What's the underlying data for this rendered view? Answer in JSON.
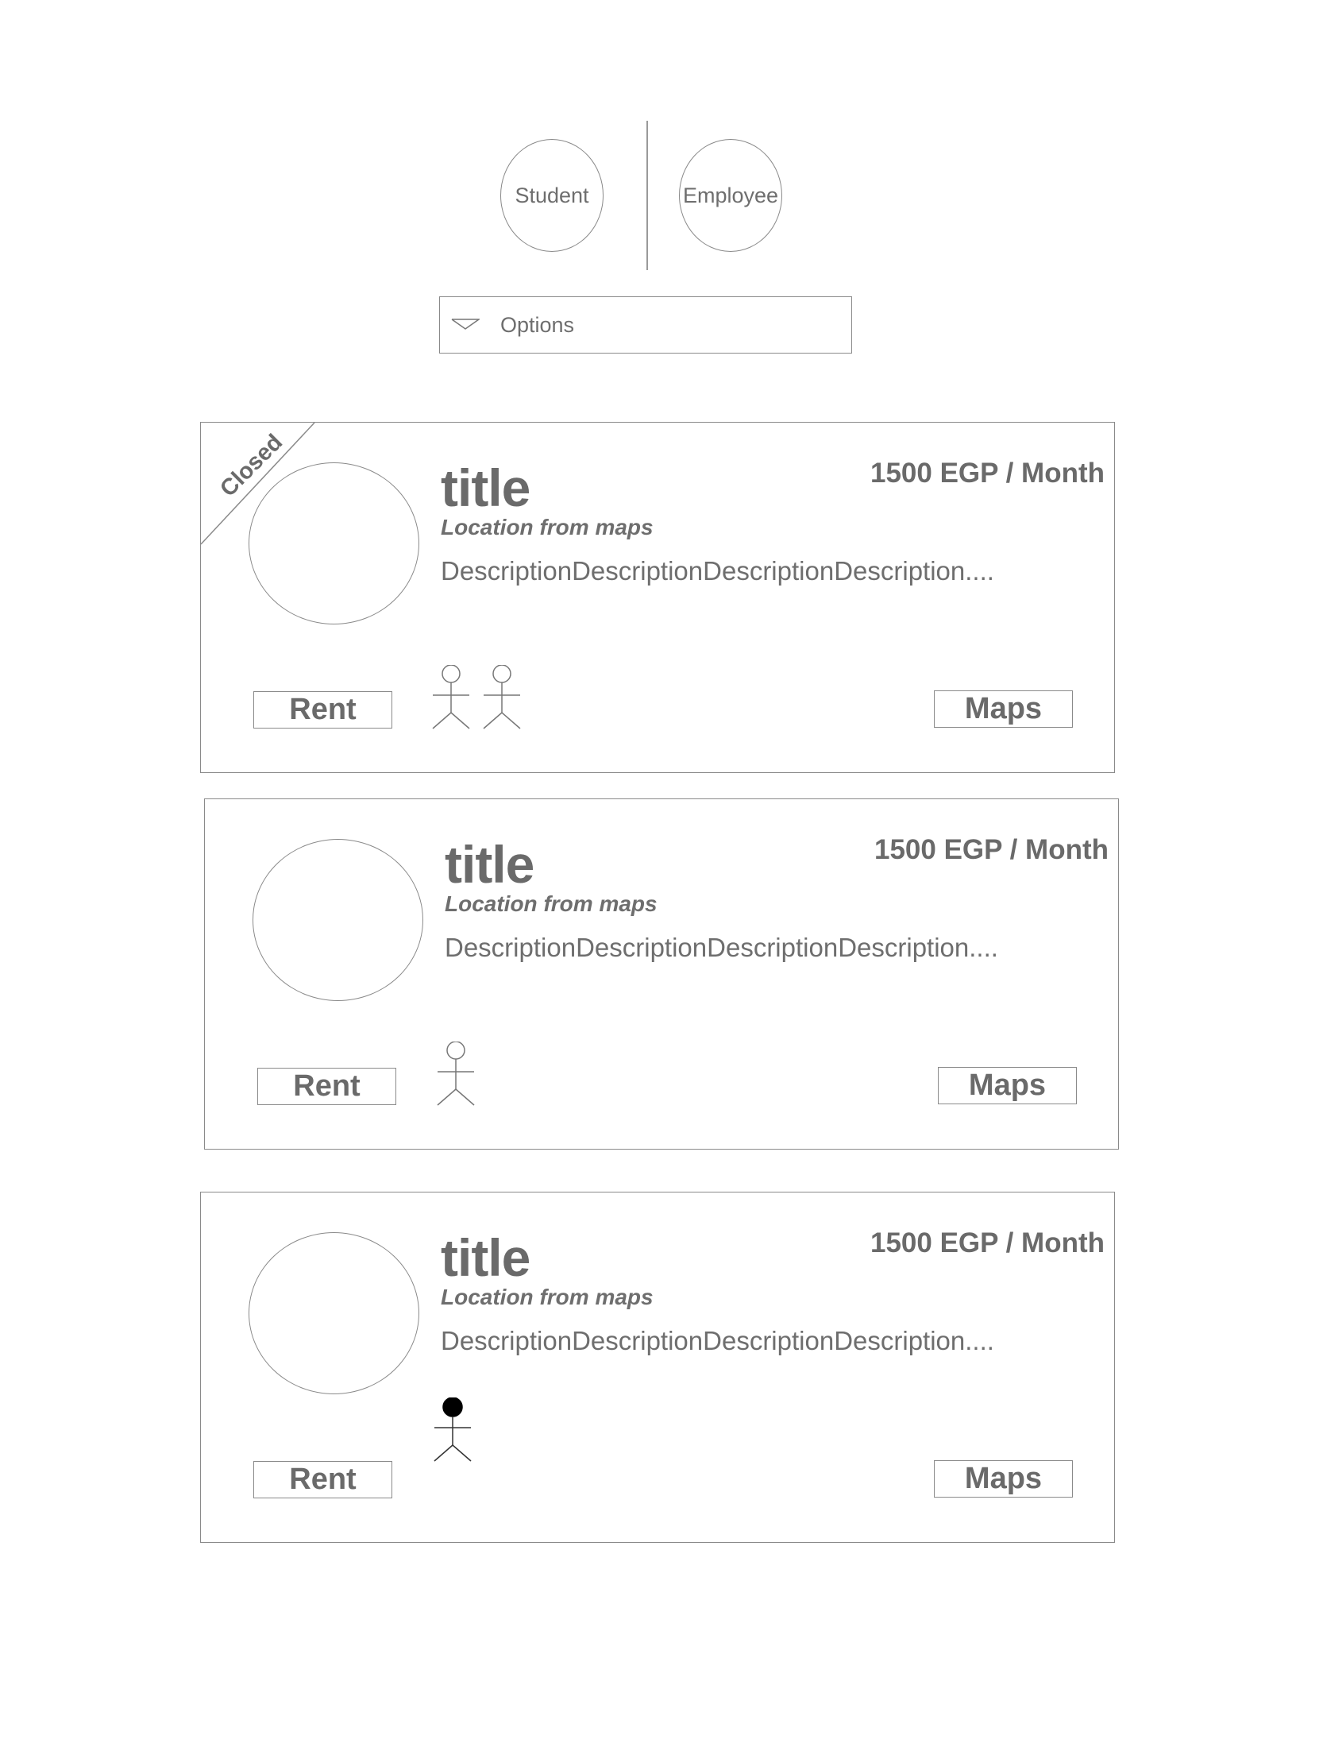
{
  "roles": {
    "student_label": "Student",
    "employee_label": "Employee"
  },
  "filter": {
    "options_label": "Options"
  },
  "listings": [
    {
      "status": "Closed",
      "title": "title",
      "location": "Location from maps",
      "description": "DescriptionDescriptionDescriptionDescription....",
      "price": "1500 EGP / Month",
      "rent_label": "Rent",
      "maps_label": "Maps",
      "occupants": 2,
      "occupant_icon": "person-outline-icon"
    },
    {
      "title": "title",
      "location": "Location from maps",
      "description": "DescriptionDescriptionDescriptionDescription....",
      "price": "1500 EGP / Month",
      "rent_label": "Rent",
      "maps_label": "Maps",
      "occupants": 1,
      "occupant_icon": "person-outline-icon"
    },
    {
      "title": "title",
      "location": "Location from maps",
      "description": "DescriptionDescriptionDescriptionDescription....",
      "price": "1500 EGP / Month",
      "rent_label": "Rent",
      "maps_label": "Maps",
      "occupants": 1,
      "occupant_icon": "person-filled-icon"
    }
  ]
}
